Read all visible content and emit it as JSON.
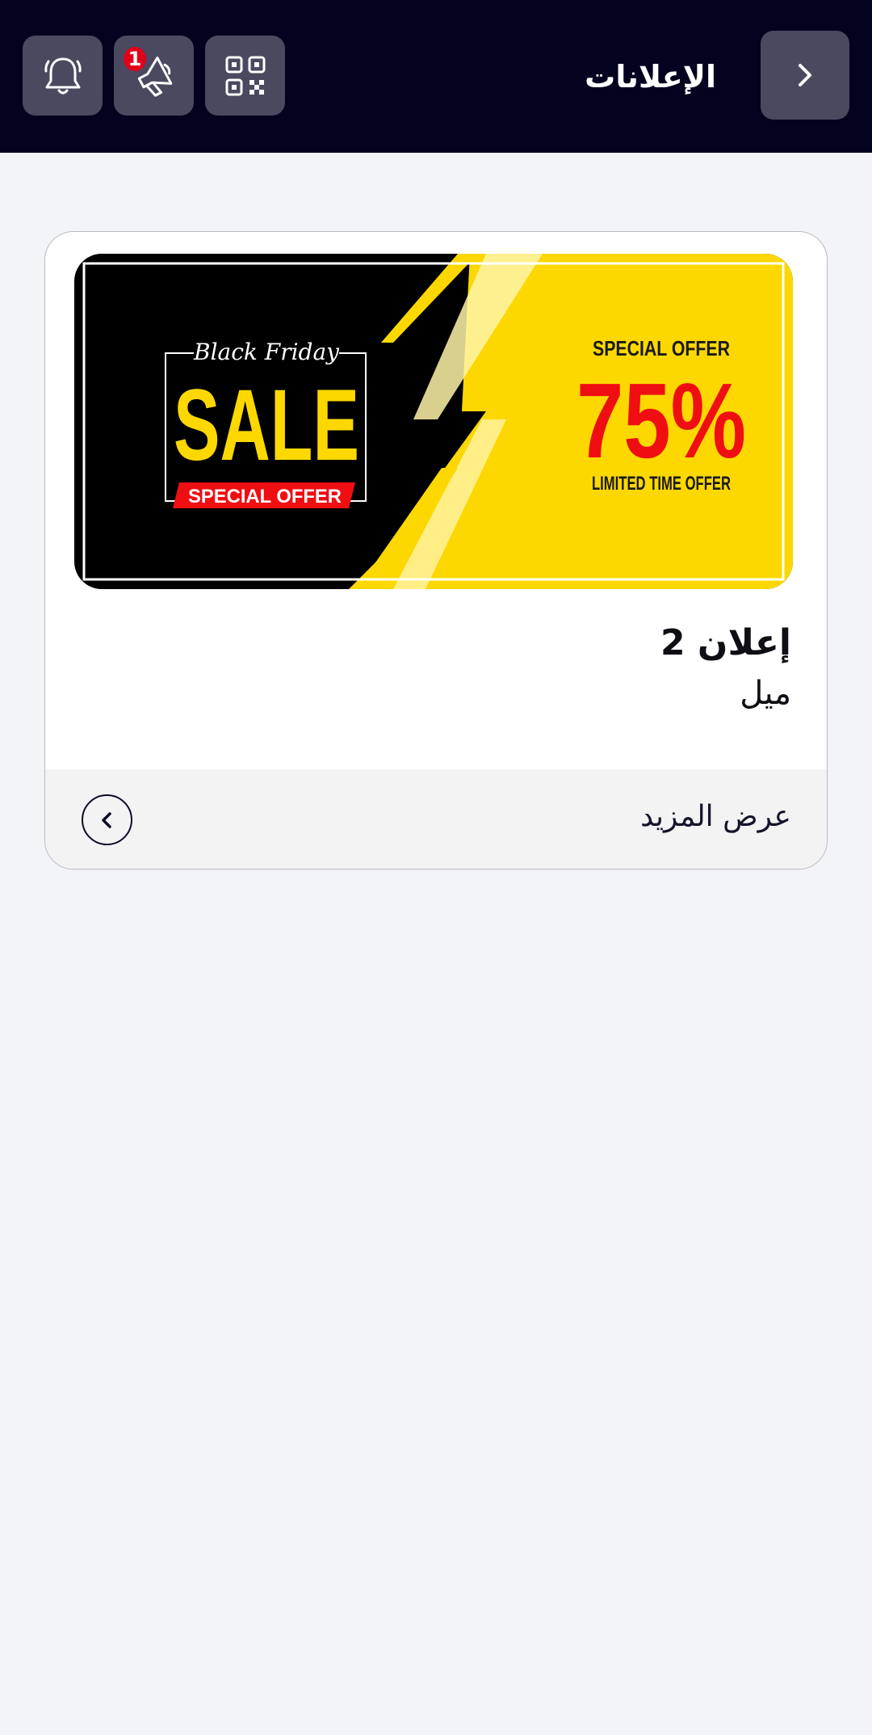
{
  "header": {
    "title": "الإعلانات",
    "background_color": "#03021f",
    "button_color": "#4a4960",
    "back_icon": "chevron-right-icon",
    "actions": [
      {
        "name": "notifications",
        "icon": "bell-icon"
      },
      {
        "name": "announcements",
        "icon": "megaphone-icon",
        "badge": "1"
      },
      {
        "name": "qr-scanner",
        "icon": "qr-code-icon"
      }
    ],
    "badge_color": "#e0001a"
  },
  "card": {
    "title": "إعلان 2",
    "subtitle": "ميل",
    "footer": {
      "label": "عرض المزيد",
      "icon": "chevron-left-icon"
    },
    "banner": {
      "script_text": "Black Friday",
      "main_text": "SALE",
      "ribbon_text": "SPECIAL OFFER",
      "offer_heading": "SPECIAL OFFER",
      "percent": "75%",
      "offer_footer": "LIMITED TIME OFFER",
      "colors": {
        "black": "#000000",
        "yellow": "#fcd800",
        "red": "#ef0e12"
      }
    }
  }
}
